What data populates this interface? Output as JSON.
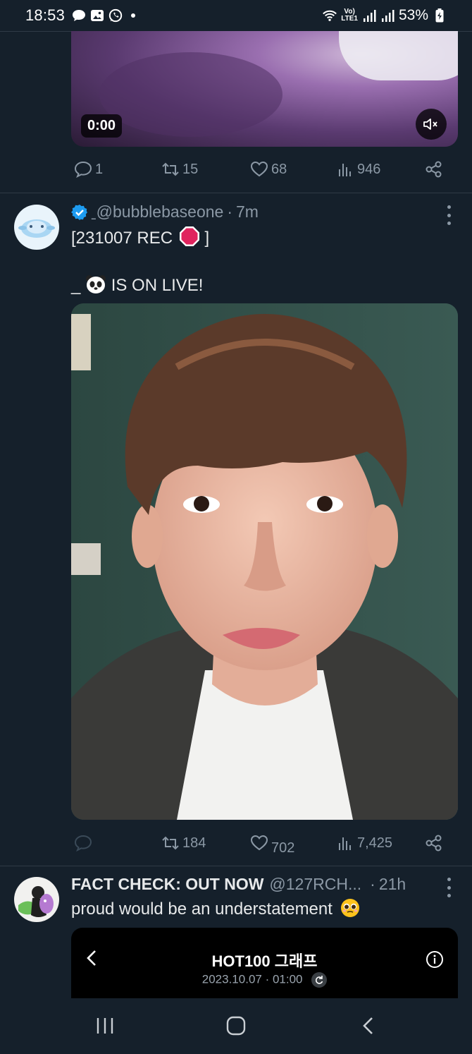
{
  "status_bar": {
    "time": "18:53",
    "network_top": "Vo)",
    "network_bottom": "LTE1",
    "battery": "53%"
  },
  "tweet_prev": {
    "video_time": "0:00",
    "stats": {
      "replies": "1",
      "retweets": "15",
      "likes": "68",
      "views": "946"
    }
  },
  "tweet_main": {
    "handle": "ˍ@bubblebaseone",
    "separator": "·",
    "time": "7m",
    "text_line1": "[231007 REC",
    "text_line2": "_",
    "text_line2_rest": "IS ON LIVE!",
    "stats": {
      "replies": "",
      "retweets": "184",
      "likes": "702",
      "views": "7,425"
    }
  },
  "tweet_next": {
    "name": "FACT CHECK: OUT NOW",
    "handle": "@127RCH...",
    "separator": "·",
    "time": "21h",
    "text": "proud would be an understatement",
    "card": {
      "title": "HOT100 그래프",
      "subtitle": "2023.10.07 · 01:00"
    }
  },
  "colors": {
    "background": "#15202b",
    "muted": "#8b98a5",
    "verified": "#1d9bf0",
    "rec_red": "#e0245e"
  },
  "icons": [
    "chat-icon",
    "image-icon",
    "whatsapp-icon",
    "wifi-icon",
    "signal-icon",
    "battery-icon",
    "reply-icon",
    "retweet-icon",
    "like-icon",
    "views-icon",
    "share-icon",
    "more-icon",
    "verified-icon",
    "stop-sign-emoji",
    "panda-emoji",
    "pleading-emoji",
    "back-icon",
    "info-icon",
    "refresh-icon",
    "recents-nav-icon",
    "home-nav-icon",
    "back-nav-icon",
    "mute-icon"
  ]
}
